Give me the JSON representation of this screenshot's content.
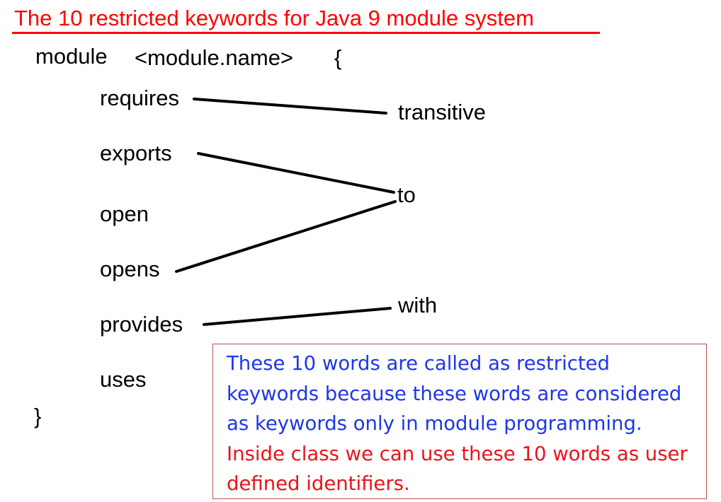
{
  "title": "The 10 restricted keywords for Java 9 module system",
  "module_header": {
    "keyword": "module",
    "name": "<module.name>",
    "open_brace": "{"
  },
  "close_brace": "}",
  "left_keywords": {
    "requires": "requires",
    "exports": "exports",
    "open": "open",
    "opens": "opens",
    "provides": "provides",
    "uses": "uses"
  },
  "right_keywords": {
    "transitive": "transitive",
    "to": "to",
    "with": "with"
  },
  "note": {
    "blue_lines": [
      "These 10 words are called as restricted",
      "keywords because these words are considered",
      "as keywords only in module programming."
    ],
    "red_lines": [
      "Inside class we can use these 10 words as user",
      "defined identifiers."
    ],
    "colors": {
      "blue": "#1e36e8",
      "red": "#e8141a",
      "border": "#c0504d",
      "title": "#ff0000"
    }
  }
}
